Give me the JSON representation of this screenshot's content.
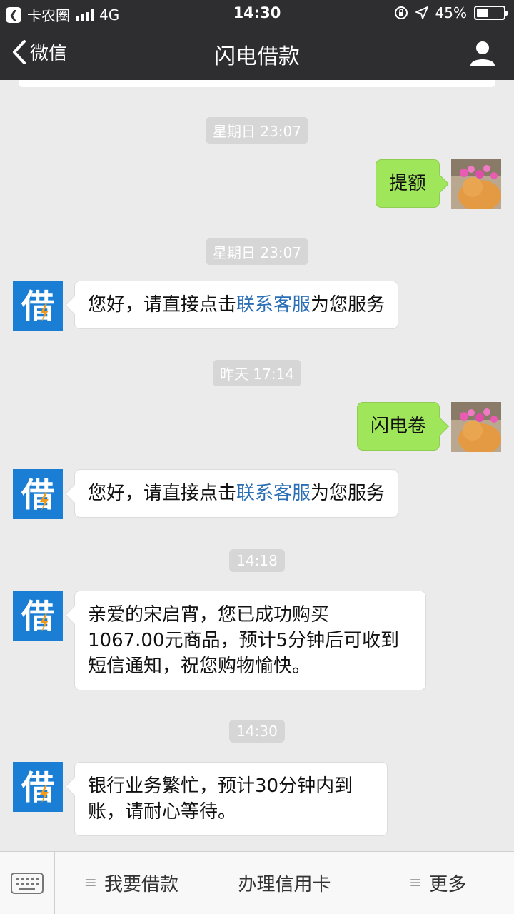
{
  "status_bar": {
    "carrier": "卡农圈",
    "network": "4G",
    "time": "14:30",
    "battery": "45%",
    "battery_level": 0.45
  },
  "nav": {
    "back_label": "微信",
    "title": "闪电借款"
  },
  "official_avatar_char": "借",
  "messages": [
    {
      "timestamp": "星期日 23:07"
    },
    {
      "outgoing": "提额"
    },
    {
      "timestamp": "星期日 23:07"
    },
    {
      "incoming": {
        "before": "您好，请直接点击",
        "link": "联系客服",
        "after": "为您服务"
      }
    },
    {
      "timestamp": "昨天 17:14"
    },
    {
      "outgoing": "闪电卷"
    },
    {
      "incoming": {
        "before": "您好，请直接点击",
        "link": "联系客服",
        "after": "为您服务"
      }
    },
    {
      "timestamp": "14:18"
    },
    {
      "incoming_lines": [
        "亲爱的宋启宵，您已成功购买",
        "1067.00元商品，预计5分钟后可收到",
        "短信通知，祝您购物愉快。"
      ]
    },
    {
      "timestamp": "14:30"
    },
    {
      "incoming_lines": [
        "银行业务繁忙，预计30分钟内到",
        "账，请耐心等待。"
      ]
    }
  ],
  "bottom_menu": {
    "item1": "我要借款",
    "item2": "办理信用卡",
    "item3": "更多"
  },
  "colors": {
    "bar_bg": "#2e2e31",
    "chat_bg": "#ebebeb",
    "outgoing_bubble": "#9fe65a",
    "official_avatar": "#1a7fd4",
    "link": "#2b6fb6"
  }
}
